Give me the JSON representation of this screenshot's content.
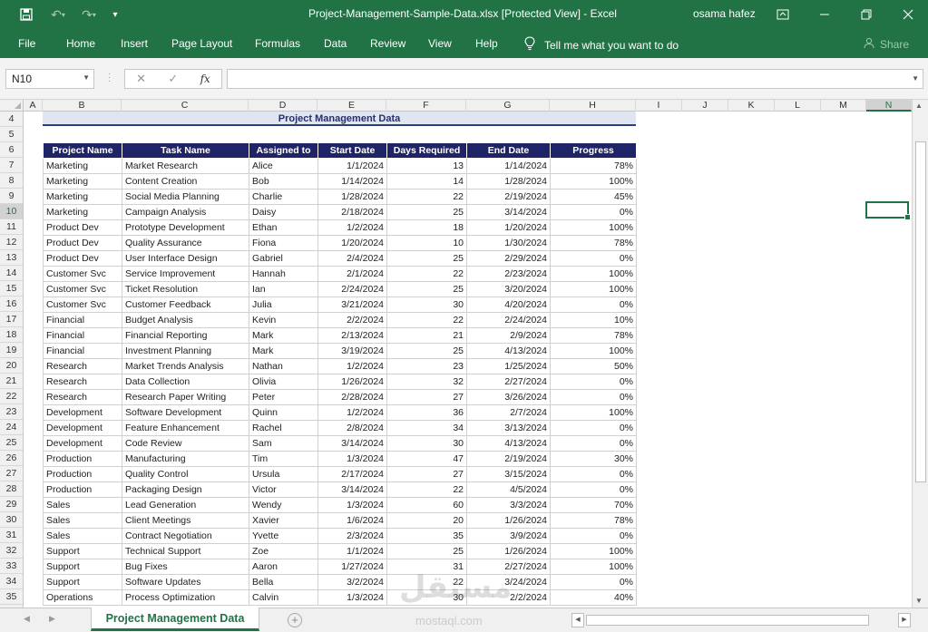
{
  "window": {
    "title": "Project-Management-Sample-Data.xlsx  [Protected View]  -  Excel",
    "user": "osama hafez",
    "accent": "#217346"
  },
  "ribbon": {
    "file": "File",
    "tabs": [
      "Home",
      "Insert",
      "Page Layout",
      "Formulas",
      "Data",
      "Review",
      "View",
      "Help"
    ],
    "tell_me": "Tell me what you want to do",
    "share": "Share"
  },
  "formula_bar": {
    "name_box": "N10",
    "fx": "fx",
    "value": ""
  },
  "columns": [
    "A",
    "B",
    "C",
    "D",
    "E",
    "F",
    "G",
    "H",
    "I",
    "J",
    "K",
    "L",
    "M",
    "N"
  ],
  "rows": [
    "4",
    "5",
    "6",
    "7",
    "8",
    "9",
    "10",
    "11",
    "12",
    "13",
    "14",
    "15",
    "16",
    "17",
    "18",
    "19",
    "20",
    "21",
    "22",
    "23",
    "24",
    "25",
    "26",
    "27",
    "28",
    "29",
    "30",
    "31",
    "32",
    "33",
    "34",
    "35"
  ],
  "sheet": {
    "title": "Project Management Data",
    "headers": [
      "Project Name",
      "Task Name",
      "Assigned to",
      "Start Date",
      "Days Required",
      "End Date",
      "Progress"
    ],
    "records": [
      [
        "Marketing",
        "Market Research",
        "Alice",
        "1/1/2024",
        "13",
        "1/14/2024",
        "78%"
      ],
      [
        "Marketing",
        "Content Creation",
        "Bob",
        "1/14/2024",
        "14",
        "1/28/2024",
        "100%"
      ],
      [
        "Marketing",
        "Social Media Planning",
        "Charlie",
        "1/28/2024",
        "22",
        "2/19/2024",
        "45%"
      ],
      [
        "Marketing",
        "Campaign Analysis",
        "Daisy",
        "2/18/2024",
        "25",
        "3/14/2024",
        "0%"
      ],
      [
        "Product Dev",
        "Prototype Development",
        "Ethan",
        "1/2/2024",
        "18",
        "1/20/2024",
        "100%"
      ],
      [
        "Product Dev",
        "Quality Assurance",
        "Fiona",
        "1/20/2024",
        "10",
        "1/30/2024",
        "78%"
      ],
      [
        "Product Dev",
        "User Interface Design",
        "Gabriel",
        "2/4/2024",
        "25",
        "2/29/2024",
        "0%"
      ],
      [
        "Customer Svc",
        "Service Improvement",
        "Hannah",
        "2/1/2024",
        "22",
        "2/23/2024",
        "100%"
      ],
      [
        "Customer Svc",
        "Ticket Resolution",
        "Ian",
        "2/24/2024",
        "25",
        "3/20/2024",
        "100%"
      ],
      [
        "Customer Svc",
        "Customer Feedback",
        "Julia",
        "3/21/2024",
        "30",
        "4/20/2024",
        "0%"
      ],
      [
        "Financial",
        "Budget Analysis",
        "Kevin",
        "2/2/2024",
        "22",
        "2/24/2024",
        "10%"
      ],
      [
        "Financial",
        "Financial Reporting",
        "Mark",
        "2/13/2024",
        "21",
        "2/9/2024",
        "78%"
      ],
      [
        "Financial",
        "Investment Planning",
        "Mark",
        "3/19/2024",
        "25",
        "4/13/2024",
        "100%"
      ],
      [
        "Research",
        "Market Trends Analysis",
        "Nathan",
        "1/2/2024",
        "23",
        "1/25/2024",
        "50%"
      ],
      [
        "Research",
        "Data Collection",
        "Olivia",
        "1/26/2024",
        "32",
        "2/27/2024",
        "0%"
      ],
      [
        "Research",
        "Research Paper Writing",
        "Peter",
        "2/28/2024",
        "27",
        "3/26/2024",
        "0%"
      ],
      [
        "Development",
        "Software Development",
        "Quinn",
        "1/2/2024",
        "36",
        "2/7/2024",
        "100%"
      ],
      [
        "Development",
        "Feature Enhancement",
        "Rachel",
        "2/8/2024",
        "34",
        "3/13/2024",
        "0%"
      ],
      [
        "Development",
        "Code Review",
        "Sam",
        "3/14/2024",
        "30",
        "4/13/2024",
        "0%"
      ],
      [
        "Production",
        "Manufacturing",
        "Tim",
        "1/3/2024",
        "47",
        "2/19/2024",
        "30%"
      ],
      [
        "Production",
        "Quality Control",
        "Ursula",
        "2/17/2024",
        "27",
        "3/15/2024",
        "0%"
      ],
      [
        "Production",
        "Packaging Design",
        "Victor",
        "3/14/2024",
        "22",
        "4/5/2024",
        "0%"
      ],
      [
        "Sales",
        "Lead Generation",
        "Wendy",
        "1/3/2024",
        "60",
        "3/3/2024",
        "70%"
      ],
      [
        "Sales",
        "Client Meetings",
        "Xavier",
        "1/6/2024",
        "20",
        "1/26/2024",
        "78%"
      ],
      [
        "Sales",
        "Contract Negotiation",
        "Yvette",
        "2/3/2024",
        "35",
        "3/9/2024",
        "0%"
      ],
      [
        "Support",
        "Technical Support",
        "Zoe",
        "1/1/2024",
        "25",
        "1/26/2024",
        "100%"
      ],
      [
        "Support",
        "Bug Fixes",
        "Aaron",
        "1/27/2024",
        "31",
        "2/27/2024",
        "100%"
      ],
      [
        "Support",
        "Software Updates",
        "Bella",
        "3/2/2024",
        "22",
        "3/24/2024",
        "0%"
      ],
      [
        "Operations",
        "Process Optimization",
        "Calvin",
        "1/3/2024",
        "30",
        "2/2/2024",
        "40%"
      ]
    ]
  },
  "sheet_tabs": {
    "active": "Project Management Data"
  },
  "watermark": {
    "text": "مستقل",
    "sub": "mostaql.com"
  }
}
